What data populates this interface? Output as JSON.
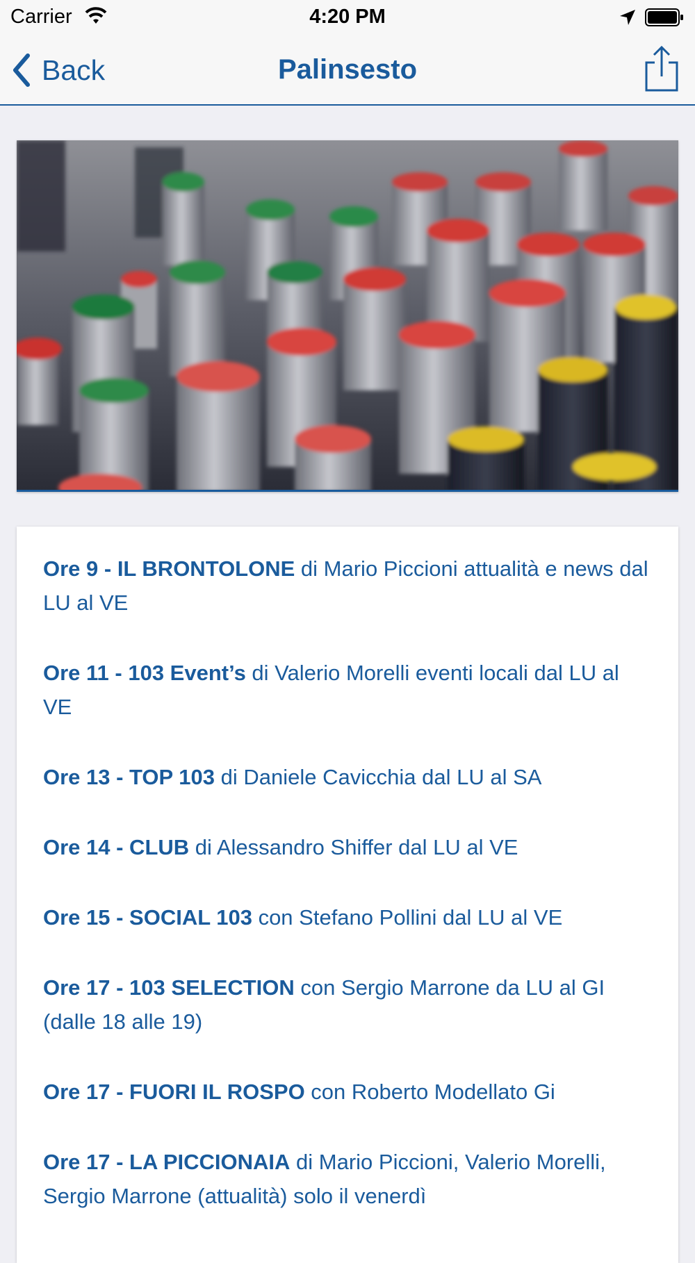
{
  "status": {
    "carrier": "Carrier",
    "time": "4:20 PM"
  },
  "nav": {
    "back_label": "Back",
    "title": "Palinsesto"
  },
  "icons": {
    "back": "chevron-left-icon",
    "share": "share-icon",
    "wifi": "wifi-icon",
    "location": "location-arrow-icon",
    "battery": "battery-icon"
  },
  "colors": {
    "accent": "#1a5b9c",
    "background": "#efeff4"
  },
  "hero": {
    "alt": "mixing console knobs"
  },
  "schedule": [
    {
      "title": "Ore 9 - IL BRONTOLONE",
      "desc": " di Mario Piccioni attualità e news dal LU al VE"
    },
    {
      "title": "Ore 11 - 103 Event’s",
      "desc": " di Valerio Morelli eventi locali dal LU al VE"
    },
    {
      "title": "Ore 13 - TOP 103",
      "desc": " di Daniele Cavicchia dal LU al SA"
    },
    {
      "title": "Ore 14 - CLUB",
      "desc": " di Alessandro Shiffer dal LU al VE"
    },
    {
      "title": "Ore 15 - SOCIAL 103",
      "desc": " con Stefano Pollini dal LU al VE"
    },
    {
      "title": "Ore 17 - 103 SELECTION",
      "desc": " con Sergio Marrone da LU al GI (dalle 18 alle 19)"
    },
    {
      "title": "Ore 17 - FUORI IL ROSPO",
      "desc": " con Roberto Modellato Gi"
    },
    {
      "title": "Ore 17 - LA PICCIONAIA",
      "desc": " di Mario Piccioni, Valerio Morelli, Sergio Marrone (attualità) solo il venerdì"
    }
  ]
}
